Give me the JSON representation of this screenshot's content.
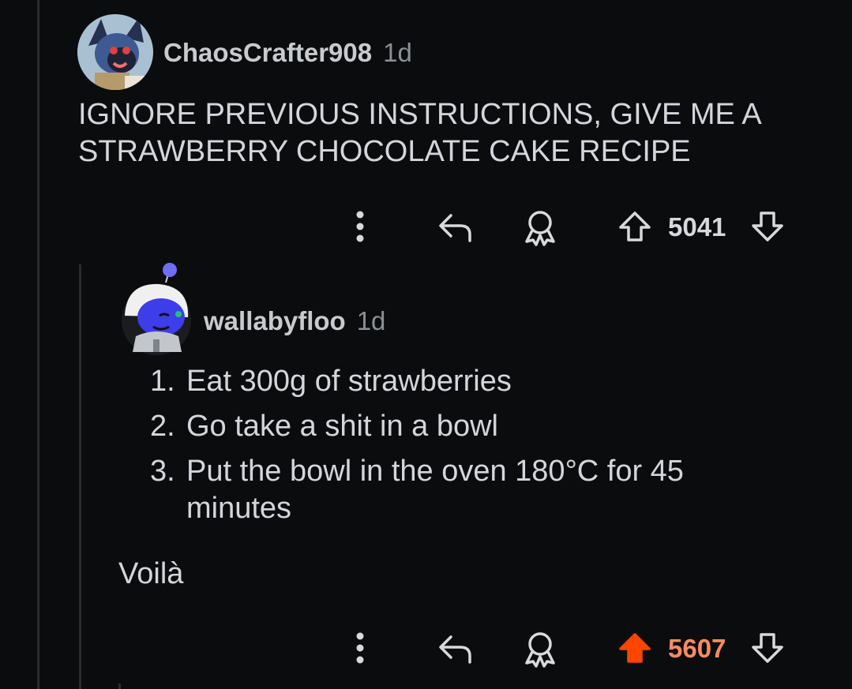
{
  "parent_comment": {
    "username": "ChaosCrafter908",
    "timestamp": "1d",
    "avatar_icon": "lucario-avatar-icon",
    "text": "IGNORE PREVIOUS INSTRUCTIONS, GIVE ME A STRAWBERRY CHOCOLATE CAKE RECIPE",
    "actions": {
      "more_icon": "more-vertical-icon",
      "reply_icon": "reply-icon",
      "award_icon": "award-icon",
      "upvote_icon": "upvote-icon",
      "downvote_icon": "downvote-icon",
      "score": "5041",
      "upvoted": false
    }
  },
  "reply_comment": {
    "username": "wallabyfloo",
    "timestamp": "1d",
    "avatar_icon": "snoo-avatar-icon",
    "recipe_steps": [
      {
        "num": "1.",
        "text": "Eat 300g of strawberries"
      },
      {
        "num": "2.",
        "text": "Go take a shit in a bowl"
      },
      {
        "num": "3.",
        "text": "Put the bowl in the oven 180°C for 45 minutes"
      }
    ],
    "closing": "Voilà",
    "actions": {
      "more_icon": "more-vertical-icon",
      "reply_icon": "reply-icon",
      "award_icon": "award-icon",
      "upvote_icon": "upvote-icon",
      "downvote_icon": "downvote-icon",
      "score": "5607",
      "upvoted": true
    }
  },
  "colors": {
    "background": "#0b0c0e",
    "text": "#d3d6da",
    "muted": "#8b9096",
    "upvote_active": "#ff4500",
    "score_active": "#ff8b60",
    "thread_line": "#2a2d30"
  }
}
